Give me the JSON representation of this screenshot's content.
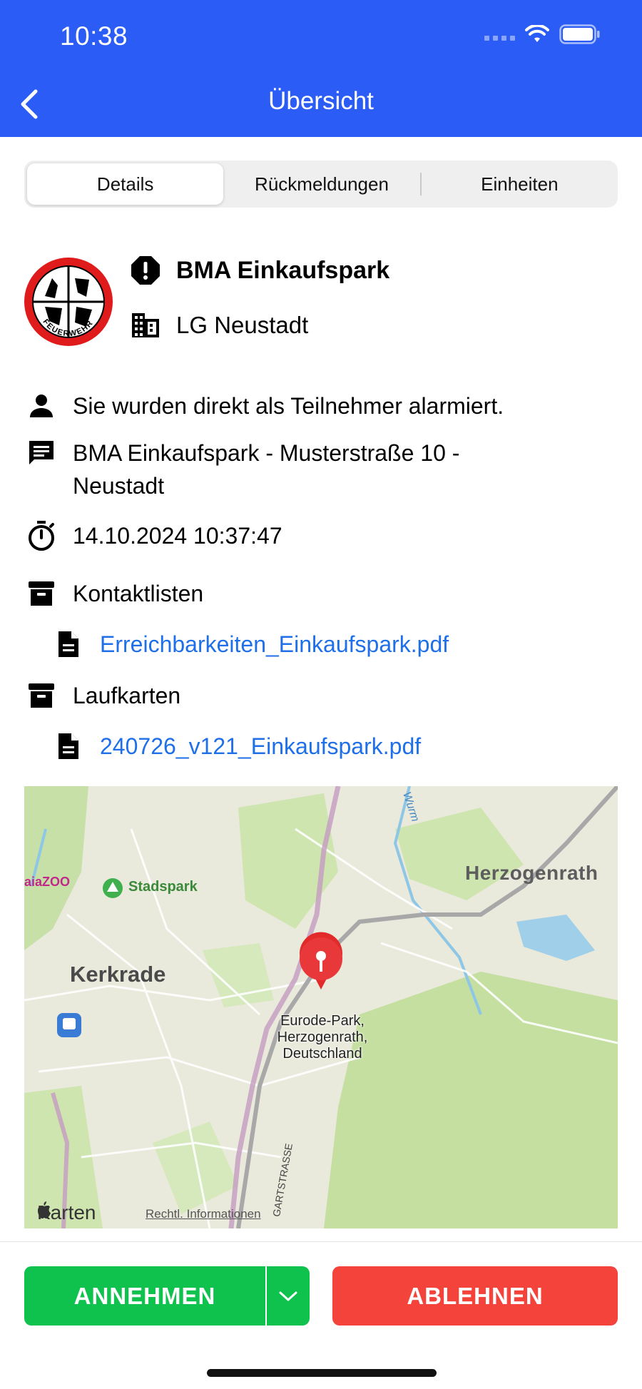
{
  "status_bar": {
    "time": "10:38"
  },
  "nav": {
    "title": "Übersicht"
  },
  "tabs": [
    {
      "label": "Details",
      "active": true
    },
    {
      "label": "Rückmeldungen",
      "active": false
    },
    {
      "label": "Einheiten",
      "active": false
    }
  ],
  "alarm": {
    "title": "BMA Einkaufspark",
    "unit": "LG Neustadt",
    "logo_text": "FEUERWEHR"
  },
  "details": {
    "participant": "Sie wurden direkt als Teilnehmer alarmiert.",
    "message_line1": "BMA Einkaufspark - Musterstraße 10 -",
    "message_line2": "Neustadt",
    "timestamp": "14.10.2024 10:37:47",
    "contact_lists_label": "Kontaktlisten",
    "contact_file": "Erreichbarkeiten_Einkaufspark.pdf",
    "route_cards_label": "Laufkarten",
    "route_file": "240726_v121_Einkaufspark.pdf"
  },
  "map": {
    "labels": {
      "herzogenrath": "Herzogenrath",
      "kerkrade": "Kerkrade",
      "stadspark": "Stadspark",
      "zoo": "aiaZOO",
      "wurm": "Wurm",
      "street": "GARTSTRASSE"
    },
    "pin_label_line1": "Eurode-Park,",
    "pin_label_line2": "Herzogenrath,",
    "pin_label_line3": "Deutschland",
    "attribution_brand": "Karten",
    "legal": "Rechtl. Informationen"
  },
  "actions": {
    "accept": "ANNEHMEN",
    "decline": "ABLEHNEN"
  },
  "colors": {
    "header": "#2b5cf5",
    "accept": "#0fc24e",
    "decline": "#f4433b",
    "link": "#1e6fe8"
  }
}
